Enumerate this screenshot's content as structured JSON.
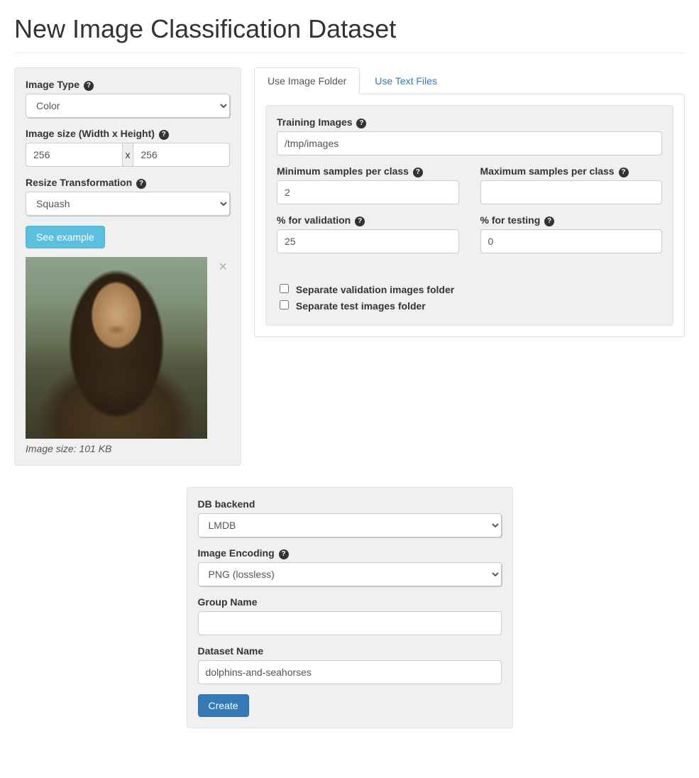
{
  "page_title": "New Image Classification Dataset",
  "left": {
    "image_type_label": "Image Type",
    "image_type_value": "Color",
    "image_size_label": "Image size (Width x Height)",
    "width": "256",
    "height": "256",
    "resize_label": "Resize Transformation",
    "resize_value": "Squash",
    "see_example_label": "See example",
    "image_caption": "Image size: 101 KB"
  },
  "tabs": {
    "folder_label": "Use Image Folder",
    "text_label": "Use Text Files",
    "folder": {
      "training_label": "Training Images",
      "training_value": "/tmp/images",
      "min_samples_label": "Minimum samples per class",
      "min_samples_value": "2",
      "max_samples_label": "Maximum samples per class",
      "max_samples_value": "",
      "pct_validation_label": "% for validation",
      "pct_validation_value": "25",
      "pct_testing_label": "% for testing",
      "pct_testing_value": "0",
      "sep_validation_label": "Separate validation images folder",
      "sep_test_label": "Separate test images folder"
    }
  },
  "bottom": {
    "db_backend_label": "DB backend",
    "db_backend_value": "LMDB",
    "encoding_label": "Image Encoding",
    "encoding_value": "PNG (lossless)",
    "group_name_label": "Group Name",
    "group_name_value": "",
    "dataset_name_label": "Dataset Name",
    "dataset_name_value": "dolphins-and-seahorses",
    "create_label": "Create"
  }
}
